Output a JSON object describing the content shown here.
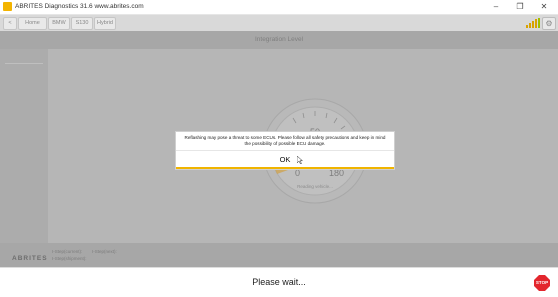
{
  "window": {
    "title": "ABRITES Diagnostics 31.6   www.abrites.com",
    "minimize": "–",
    "maximize": "❐",
    "close": "✕"
  },
  "toolbar": {
    "back": "<",
    "home": "Home",
    "bmw": "BMW",
    "sub": "S130",
    "hybrid": "Hybrid"
  },
  "main": {
    "header": "Integration Level"
  },
  "gauge": {
    "ticks": [
      "40",
      "50",
      "60",
      "0",
      "180"
    ],
    "status": "Reading vehicle..."
  },
  "footer": {
    "brand": "ABRITES",
    "info1": "I-Step(current):",
    "info2": "I-Step(next):",
    "info3": "I-Step(shipment):"
  },
  "status": {
    "text": "Please wait...",
    "stop": "STOP"
  },
  "dialog": {
    "message": "Reflashing may pose a threat to some ECUs. Please follow all safety precautions and keep in mind\nthe possibility of possible ECU damage.",
    "ok": "OK"
  },
  "colors": {
    "accent": "#f0b400",
    "stop": "#e3262d"
  }
}
